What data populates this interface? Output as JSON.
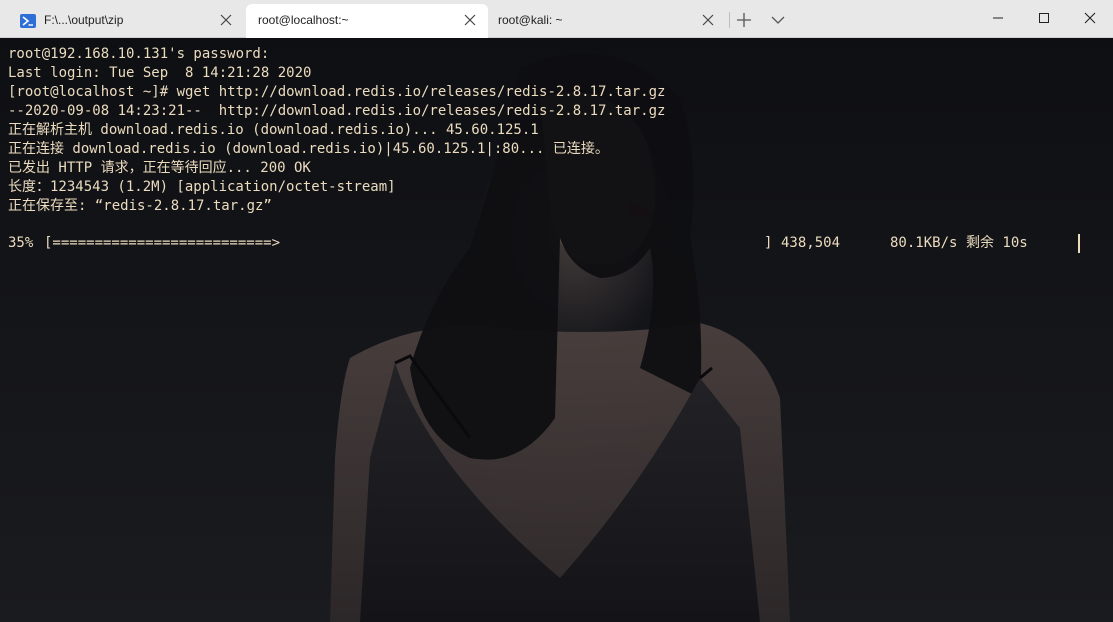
{
  "tabs": [
    {
      "label": "F:\\...\\output\\zip",
      "icon": "powershell-icon",
      "active": false
    },
    {
      "label": "root@localhost:~",
      "active": true
    },
    {
      "label": "root@kali: ~",
      "active": false
    }
  ],
  "window_controls": {
    "new_tab": "+",
    "dropdown": "chevron-down-icon",
    "minimize": "minimize-icon",
    "maximize": "maximize-icon",
    "close": "close-icon"
  },
  "terminal": {
    "lines": [
      "root@192.168.10.131's password:",
      "Last login: Tue Sep  8 14:21:28 2020",
      "[root@localhost ~]# wget http://download.redis.io/releases/redis-2.8.17.tar.gz",
      "--2020-09-08 14:23:21--  http://download.redis.io/releases/redis-2.8.17.tar.gz",
      "正在解析主机 download.redis.io (download.redis.io)... 45.60.125.1",
      "正在连接 download.redis.io (download.redis.io)|45.60.125.1|:80... 已连接。",
      "已发出 HTTP 请求，正在等待回应... 200 OK",
      "长度：1234543 (1.2M) [application/octet-stream]",
      "正在保存至: “redis-2.8.17.tar.gz”"
    ],
    "progress": {
      "percent_text": "35%",
      "bar": "[==========================>",
      "bar_end": "]",
      "bytes": "438,504",
      "speed": "80.1KB/s",
      "eta": "剩余 10s"
    }
  },
  "colors": {
    "text": "#ecdcbf",
    "tabbar": "#e8e8e8",
    "active_tab": "#ffffff",
    "powershell_icon": "#2d6fd6"
  }
}
